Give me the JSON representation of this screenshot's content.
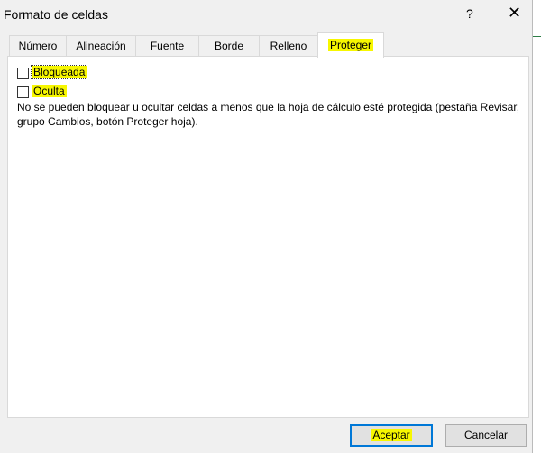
{
  "dialog": {
    "title": "Formato de celdas",
    "help": "?",
    "close": "✕"
  },
  "tabs": [
    {
      "label": "Número"
    },
    {
      "label": "Alineación"
    },
    {
      "label": "Fuente"
    },
    {
      "label": "Borde"
    },
    {
      "label": "Relleno"
    },
    {
      "label": "Proteger",
      "selected": true
    }
  ],
  "options": {
    "locked": {
      "label": "Bloqueada",
      "checked": false
    },
    "hidden": {
      "label": "Oculta",
      "checked": false
    }
  },
  "note": "No se pueden bloquear u ocultar celdas a menos que la hoja de cálculo esté protegida (pestaña Revisar, grupo Cambios, botón Proteger hoja).",
  "buttons": {
    "ok": "Aceptar",
    "cancel": "Cancelar"
  },
  "colors": {
    "highlight": "#f7f700",
    "default_button_border": "#0078d7"
  }
}
